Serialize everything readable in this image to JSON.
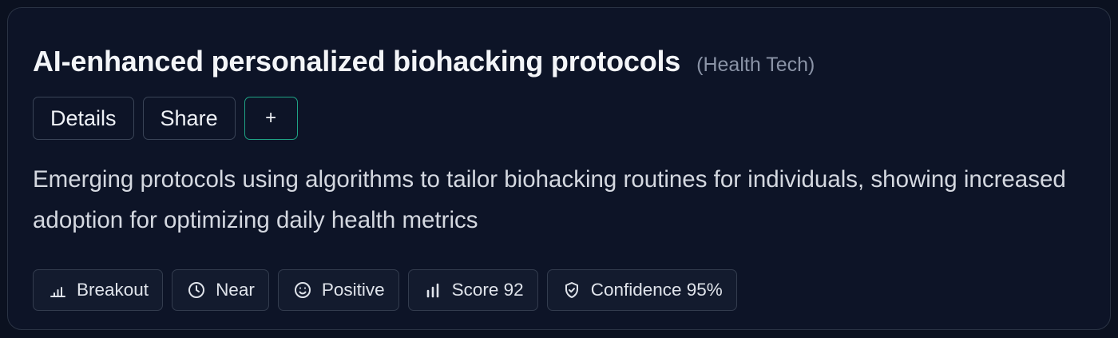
{
  "trend": {
    "title": "AI-enhanced personalized biohacking protocols",
    "category": "(Health Tech)",
    "description": "Emerging protocols using algorithms to tailor biohacking routines for individuals, showing increased adoption for optimizing daily health metrics"
  },
  "actions": {
    "details_label": "Details",
    "share_label": "Share",
    "add_label": "+"
  },
  "tags": [
    {
      "icon": "bar-chart-icon",
      "label": "Breakout"
    },
    {
      "icon": "clock-icon",
      "label": "Near"
    },
    {
      "icon": "smile-icon",
      "label": "Positive"
    },
    {
      "icon": "bar-chart-icon",
      "label": "Score 92"
    },
    {
      "icon": "shield-check-icon",
      "label": "Confidence 95%"
    }
  ],
  "colors": {
    "background": "#0b1120",
    "card": "#0d1427",
    "accent": "#1fa385",
    "muted_text": "#8a93a6"
  }
}
